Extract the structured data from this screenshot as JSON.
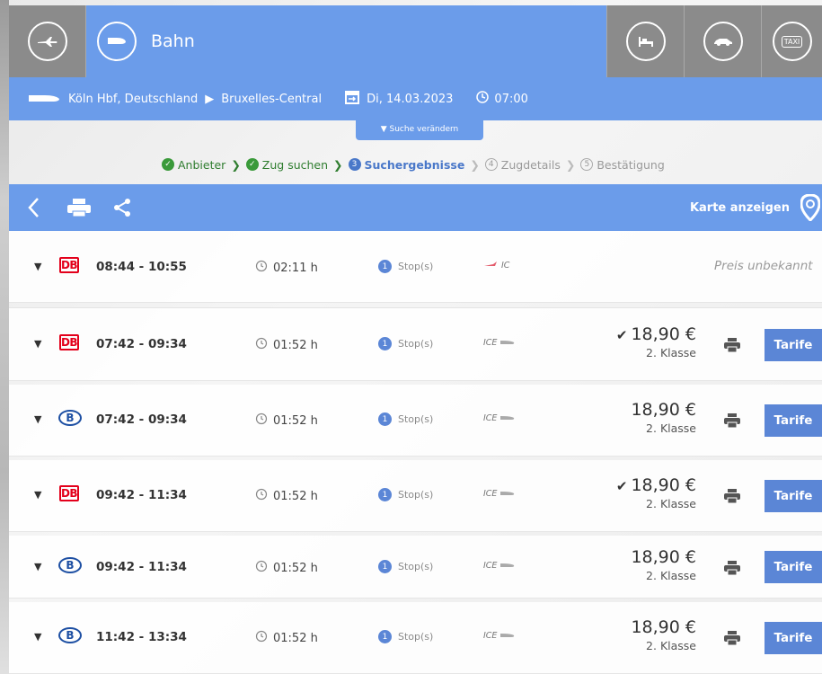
{
  "modes": {
    "active_label": "Bahn",
    "taxi_label": "TAXI"
  },
  "route": {
    "origin": "Köln Hbf, Deutschland",
    "destination": "Bruxelles-Central",
    "date": "Di,  14.03.2023",
    "time": "07:00"
  },
  "change_search_label": "Suche verändern",
  "steps": [
    {
      "num": "✓",
      "label": "Anbieter",
      "state": "done"
    },
    {
      "num": "✓",
      "label": "Zug suchen",
      "state": "done"
    },
    {
      "num": "3",
      "label": "Suchergebnisse",
      "state": "current"
    },
    {
      "num": "4",
      "label": "Zugdetails",
      "state": "todo"
    },
    {
      "num": "5",
      "label": "Bestätigung",
      "state": "todo"
    }
  ],
  "toolbar": {
    "map_label": "Karte anzeigen"
  },
  "results": [
    {
      "operator": "DB",
      "time": "08:44 - 10:55",
      "duration": "02:11 h",
      "stops": "1",
      "stops_label": "Stop(s)",
      "train": "IC",
      "price": "",
      "checked": false,
      "klasse": "",
      "price_unknown": "Preis unbekannt"
    },
    {
      "operator": "DB",
      "time": "07:42 - 09:34",
      "duration": "01:52 h",
      "stops": "1",
      "stops_label": "Stop(s)",
      "train": "ICE",
      "price": "18,90 €",
      "checked": true,
      "klasse": "2. Klasse",
      "tarife": "Tarife"
    },
    {
      "operator": "B",
      "time": "07:42 - 09:34",
      "duration": "01:52 h",
      "stops": "1",
      "stops_label": "Stop(s)",
      "train": "ICE",
      "price": "18,90 €",
      "checked": false,
      "klasse": "2. Klasse",
      "tarife": "Tarife"
    },
    {
      "operator": "DB",
      "time": "09:42 - 11:34",
      "duration": "01:52 h",
      "stops": "1",
      "stops_label": "Stop(s)",
      "train": "ICE",
      "price": "18,90 €",
      "checked": true,
      "klasse": "2. Klasse",
      "tarife": "Tarife"
    },
    {
      "operator": "B",
      "time": "09:42 - 11:34",
      "duration": "01:52 h",
      "stops": "1",
      "stops_label": "Stop(s)",
      "train": "ICE",
      "price": "18,90 €",
      "checked": false,
      "klasse": "2. Klasse",
      "tarife": "Tarife"
    },
    {
      "operator": "B",
      "time": "11:42 - 13:34",
      "duration": "01:52 h",
      "stops": "1",
      "stops_label": "Stop(s)",
      "train": "ICE",
      "price": "18,90 €",
      "checked": false,
      "klasse": "2. Klasse",
      "tarife": "Tarife"
    }
  ],
  "colors": {
    "accent": "#6b9cea",
    "button": "#5b86d6",
    "db_red": "#e3001b",
    "sncb_blue": "#1d4fa3",
    "done_green": "#3a9a3a"
  }
}
